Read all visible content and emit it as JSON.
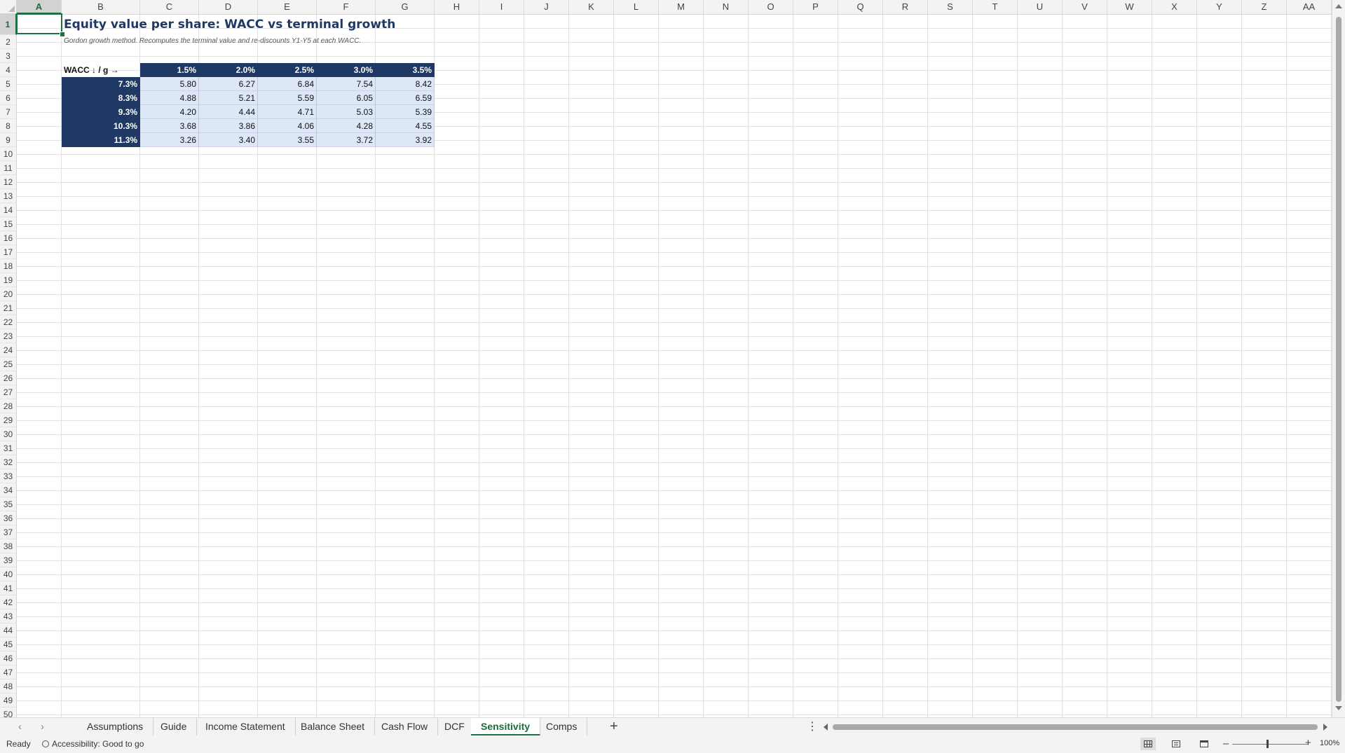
{
  "columns": [
    "A",
    "B",
    "C",
    "D",
    "E",
    "F",
    "G",
    "H",
    "I",
    "J",
    "K",
    "L",
    "M",
    "N",
    "O",
    "P",
    "Q",
    "R",
    "S",
    "T",
    "U",
    "V",
    "W",
    "X",
    "Y",
    "Z",
    "AA"
  ],
  "rows": [
    "1",
    "2",
    "3",
    "4",
    "5",
    "6",
    "7",
    "8",
    "9",
    "10",
    "11",
    "12",
    "13",
    "14",
    "15",
    "16",
    "17",
    "18",
    "19",
    "20",
    "21",
    "22",
    "23",
    "24",
    "25",
    "26",
    "27",
    "28",
    "29",
    "30",
    "31",
    "32",
    "33",
    "34",
    "35",
    "36",
    "37",
    "38",
    "39",
    "40",
    "41",
    "42",
    "43",
    "44",
    "45",
    "46",
    "47",
    "48",
    "49",
    "50"
  ],
  "selected_cell": {
    "column": "A",
    "row": "1"
  },
  "sheet": {
    "title": "Equity value per share: WACC vs terminal growth",
    "subtitle": "Gordon growth method. Recomputes the terminal value and re-discounts Y1-Y5 at each WACC.",
    "table": {
      "corner_label": "WACC ↓ / g →",
      "growth_headers": [
        "1.5%",
        "2.0%",
        "2.5%",
        "3.0%",
        "3.5%"
      ],
      "rows": [
        {
          "wacc": "7.3%",
          "values": [
            "5.80",
            "6.27",
            "6.84",
            "7.54",
            "8.42"
          ]
        },
        {
          "wacc": "8.3%",
          "values": [
            "4.88",
            "5.21",
            "5.59",
            "6.05",
            "6.59"
          ]
        },
        {
          "wacc": "9.3%",
          "values": [
            "4.20",
            "4.44",
            "4.71",
            "5.03",
            "5.39"
          ]
        },
        {
          "wacc": "10.3%",
          "values": [
            "3.68",
            "3.86",
            "4.06",
            "4.28",
            "4.55"
          ]
        },
        {
          "wacc": "11.3%",
          "values": [
            "3.26",
            "3.40",
            "3.55",
            "3.72",
            "3.92"
          ]
        }
      ]
    }
  },
  "tabs": [
    {
      "label": "Assumptions",
      "active": false
    },
    {
      "label": "Guide",
      "active": false
    },
    {
      "label": "Income Statement",
      "active": false
    },
    {
      "label": "Balance Sheet",
      "active": false
    },
    {
      "label": "Cash Flow",
      "active": false
    },
    {
      "label": "DCF",
      "active": false
    },
    {
      "label": "Sensitivity",
      "active": true
    },
    {
      "label": "Comps",
      "active": false
    }
  ],
  "status": {
    "ready": "Ready",
    "accessibility": "Accessibility: Good to go",
    "zoom": "100%"
  },
  "colors": {
    "header_fill": "#1f3864",
    "value_fill": "#dde7f7",
    "accent": "#1e7145"
  }
}
